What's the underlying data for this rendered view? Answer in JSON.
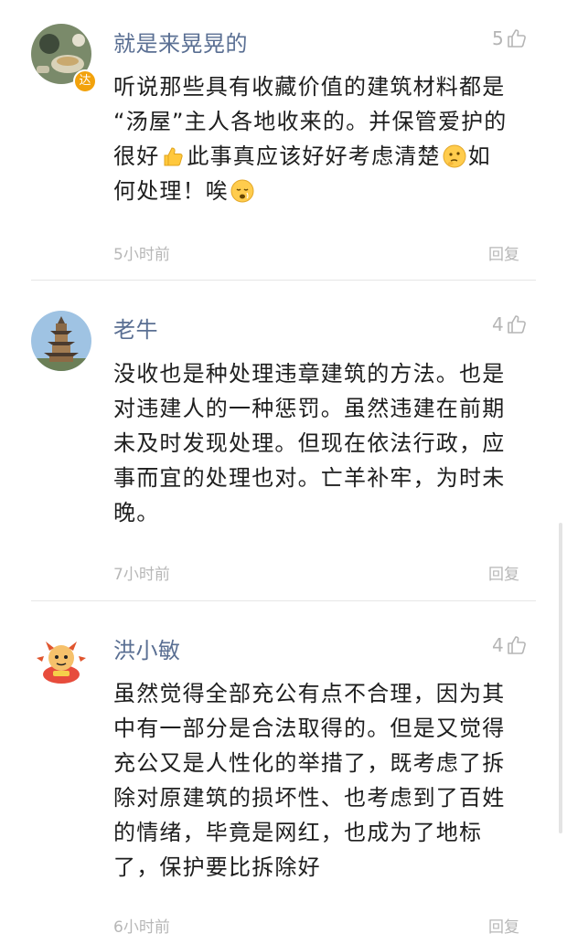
{
  "comments": [
    {
      "author": "就是来晃晃的",
      "likes": "5",
      "badge": "达",
      "lines": [
        "听说那些具有收藏价值的建筑材料都是",
        "“汤屋”主人各地收来的。并保管爱护的",
        [
          "很好",
          "thumbs-up-emoji",
          "此事真应该好好考虑清楚",
          "thinking-emoji",
          "如"
        ],
        [
          "何处理！唉",
          "sad-face-emoji"
        ]
      ],
      "time": "5小时前",
      "reply_label": "回复"
    },
    {
      "author": "老牛",
      "likes": "4",
      "lines": [
        "没收也是种处理违章建筑的方法。也是",
        "对违建人的一种惩罚。虽然违建在前期",
        "未及时发现处理。但现在依法行政，应",
        "事而宜的处理也对。亡羊补牢，为时未",
        "晚。"
      ],
      "time": "7小时前",
      "reply_label": "回复"
    },
    {
      "author": "洪小敏",
      "likes": "4",
      "lines": [
        "虽然觉得全部充公有点不合理，因为其",
        "中有一部分是合法取得的。但是又觉得",
        "充公又是人性化的举措了，既考虑了拆",
        "除对原建筑的损坏性、也考虑到了百姓",
        "的情绪，毕竟是网红，也成为了地标",
        "了，保护要比拆除好"
      ],
      "time": "6小时前",
      "reply_label": "回复"
    }
  ]
}
